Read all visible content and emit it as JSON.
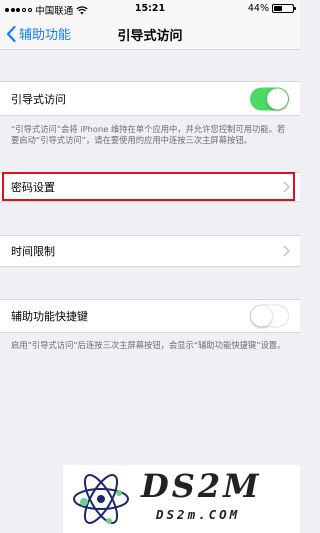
{
  "status_bar": {
    "carrier": "中国联通",
    "time": "15:21",
    "battery": "44%"
  },
  "nav": {
    "back_label": "辅助功能",
    "title": "引导式访问"
  },
  "guided_access": {
    "label": "引导式访问",
    "enabled": true,
    "description": "“引导式访问”会将 iPhone 维持在单个应用中，并允许您控制可用功能。若要启动“引导式访问”，请在要使用的应用中连按三次主屏幕按钮。"
  },
  "passcode_settings": {
    "label": "密码设置"
  },
  "time_limits": {
    "label": "时间限制"
  },
  "accessibility_shortcut": {
    "label": "辅助功能快捷键",
    "enabled": false,
    "description": "启用“引导式访问”后连按三次主屏幕按钮，会显示“辅助功能快捷键”设置。"
  },
  "watermark": {
    "brand": "DS2M",
    "domain": "DS2m.COM"
  },
  "colors": {
    "accent": "#147efb",
    "toggle_on": "#4cd964",
    "highlight": "#e01020",
    "background": "#efeff4"
  }
}
